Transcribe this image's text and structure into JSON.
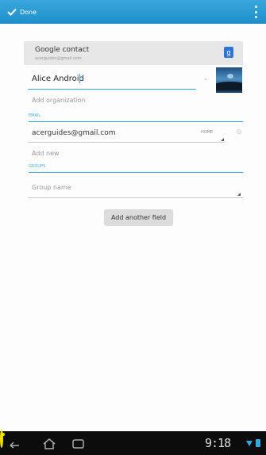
{
  "action_bar": {
    "done_label": "Done"
  },
  "account": {
    "title": "Google contact",
    "email": "acerguides@gmail.com"
  },
  "form": {
    "name_value": "Alice Android",
    "organization_placeholder": "Add organization",
    "email_section": "EMAIL",
    "email_value": "acerguides@gmail.com",
    "email_type": "HOME",
    "add_new_label": "Add new",
    "groups_section": "GROUPS",
    "group_placeholder": "Group name",
    "add_field_button": "Add another field"
  },
  "status_bar": {
    "time": "9:18"
  },
  "colors": {
    "accent": "#35a3dd",
    "action_bar": "#1f8fca",
    "nav_bar": "#0c0c0c",
    "center_button": "#f2e100"
  }
}
